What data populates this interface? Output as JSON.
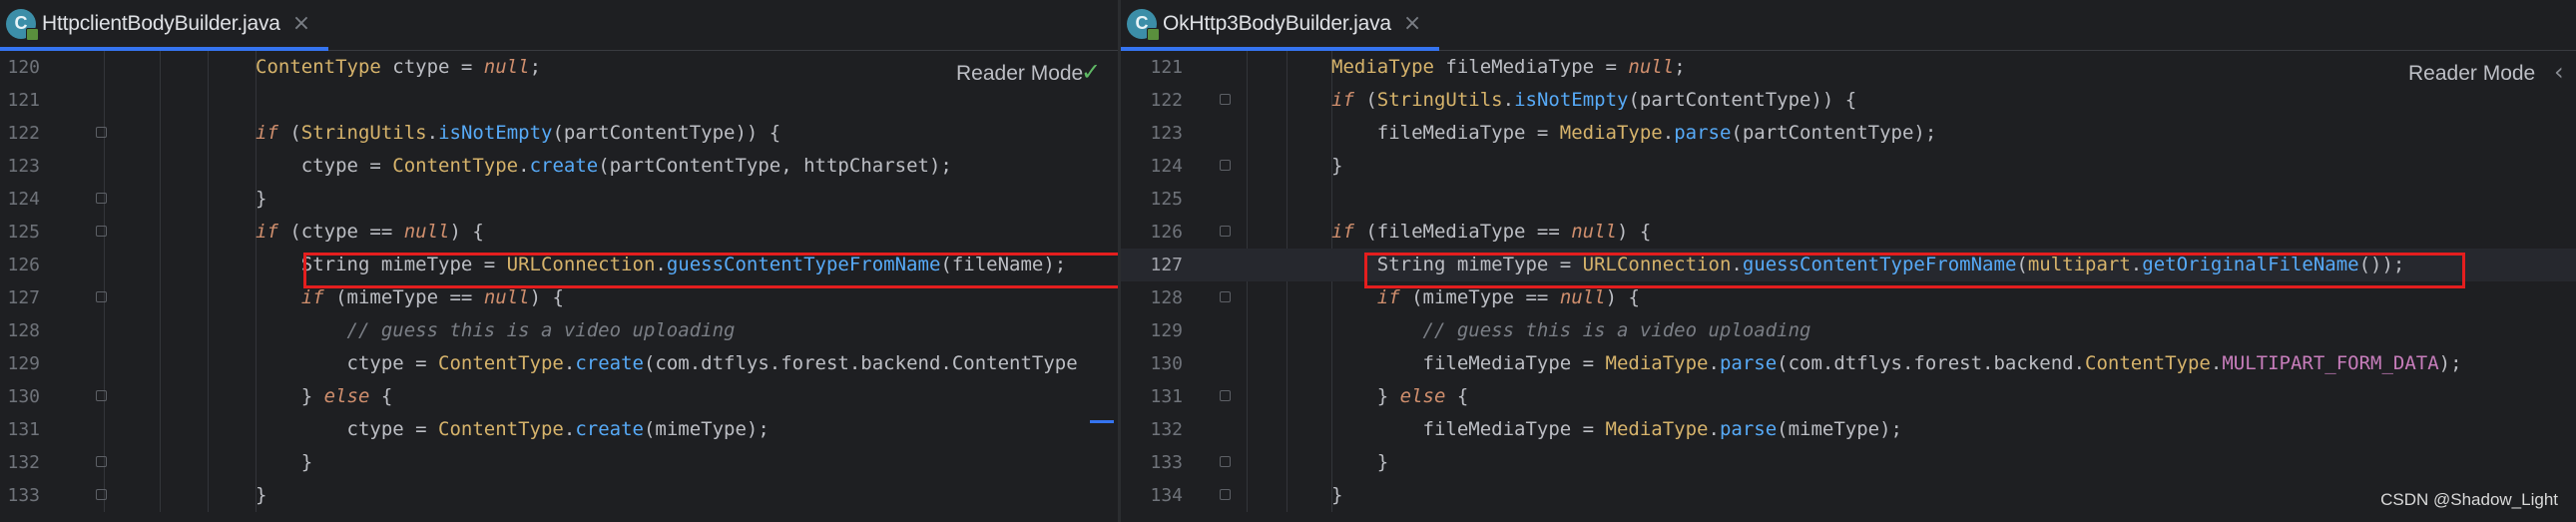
{
  "left": {
    "tab": {
      "title": "HttpclientBodyBuilder.java",
      "close": "×"
    },
    "reader_mode": "Reader Mode",
    "lines": [
      {
        "n": "120",
        "tokens": [
          {
            "t": "ContentType",
            "c": "ty"
          },
          {
            "t": " ctype = "
          },
          {
            "t": "null",
            "c": "kw"
          },
          {
            "t": ";"
          }
        ]
      },
      {
        "n": "121",
        "tokens": []
      },
      {
        "n": "122",
        "tokens": [
          {
            "t": "if",
            "c": "kw"
          },
          {
            "t": " ("
          },
          {
            "t": "StringUtils",
            "c": "ty"
          },
          {
            "t": "."
          },
          {
            "t": "isNotEmpty",
            "c": "me"
          },
          {
            "t": "(partContentType)) {"
          }
        ]
      },
      {
        "n": "123",
        "tokens": [
          {
            "t": "    ctype = "
          },
          {
            "t": "ContentType",
            "c": "ty"
          },
          {
            "t": "."
          },
          {
            "t": "create",
            "c": "me"
          },
          {
            "t": "(partContentType, httpCharset);"
          }
        ]
      },
      {
        "n": "124",
        "tokens": [
          {
            "t": "}"
          }
        ]
      },
      {
        "n": "125",
        "tokens": [
          {
            "t": "if",
            "c": "kw"
          },
          {
            "t": " (ctype == "
          },
          {
            "t": "null",
            "c": "kw"
          },
          {
            "t": ") {"
          }
        ]
      },
      {
        "n": "126",
        "tokens": [
          {
            "t": "    String mimeType = "
          },
          {
            "t": "URLConnection",
            "c": "ty"
          },
          {
            "t": "."
          },
          {
            "t": "guessContentTypeFromName",
            "c": "me"
          },
          {
            "t": "(fileName);"
          }
        ]
      },
      {
        "n": "127",
        "tokens": [
          {
            "t": "    "
          },
          {
            "t": "if",
            "c": "kw"
          },
          {
            "t": " (mimeType == "
          },
          {
            "t": "null",
            "c": "kw"
          },
          {
            "t": ") {"
          }
        ]
      },
      {
        "n": "128",
        "tokens": [
          {
            "t": "        "
          },
          {
            "t": "// guess this is a video uploading",
            "c": "cm"
          }
        ]
      },
      {
        "n": "129",
        "tokens": [
          {
            "t": "        ctype = "
          },
          {
            "t": "ContentType",
            "c": "ty"
          },
          {
            "t": "."
          },
          {
            "t": "create",
            "c": "me"
          },
          {
            "t": "(com.dtflys.forest.backend.ContentType"
          }
        ]
      },
      {
        "n": "130",
        "tokens": [
          {
            "t": "    } "
          },
          {
            "t": "else",
            "c": "kw"
          },
          {
            "t": " {"
          }
        ]
      },
      {
        "n": "131",
        "tokens": [
          {
            "t": "        ctype = "
          },
          {
            "t": "ContentType",
            "c": "ty"
          },
          {
            "t": "."
          },
          {
            "t": "create",
            "c": "me"
          },
          {
            "t": "(mimeType);"
          }
        ]
      },
      {
        "n": "132",
        "tokens": [
          {
            "t": "    }"
          }
        ]
      },
      {
        "n": "133",
        "tokens": [
          {
            "t": "}"
          }
        ]
      }
    ]
  },
  "right": {
    "tab": {
      "title": "OkHttp3BodyBuilder.java",
      "close": "×"
    },
    "reader_mode": "Reader Mode",
    "lines": [
      {
        "n": "121",
        "tokens": [
          {
            "t": "MediaType",
            "c": "ty"
          },
          {
            "t": " fileMediaType = "
          },
          {
            "t": "null",
            "c": "kw"
          },
          {
            "t": ";"
          }
        ]
      },
      {
        "n": "122",
        "tokens": [
          {
            "t": "if",
            "c": "kw"
          },
          {
            "t": " ("
          },
          {
            "t": "StringUtils",
            "c": "ty"
          },
          {
            "t": "."
          },
          {
            "t": "isNotEmpty",
            "c": "me"
          },
          {
            "t": "(partContentType)) {"
          }
        ]
      },
      {
        "n": "123",
        "tokens": [
          {
            "t": "    fileMediaType = "
          },
          {
            "t": "MediaType",
            "c": "ty"
          },
          {
            "t": "."
          },
          {
            "t": "parse",
            "c": "me"
          },
          {
            "t": "(partContentType);"
          }
        ]
      },
      {
        "n": "124",
        "tokens": [
          {
            "t": "}"
          }
        ]
      },
      {
        "n": "125",
        "tokens": []
      },
      {
        "n": "126",
        "tokens": [
          {
            "t": "if",
            "c": "kw"
          },
          {
            "t": " (fileMediaType == "
          },
          {
            "t": "null",
            "c": "kw"
          },
          {
            "t": ") {"
          }
        ]
      },
      {
        "n": "127",
        "tokens": [
          {
            "t": "    String mimeType = "
          },
          {
            "t": "URLConnection",
            "c": "ty"
          },
          {
            "t": "."
          },
          {
            "t": "guessContentTypeFromName",
            "c": "me"
          },
          {
            "t": "("
          },
          {
            "t": "multipart",
            "c": "ty"
          },
          {
            "t": "."
          },
          {
            "t": "getOriginalFileName",
            "c": "me"
          },
          {
            "t": "());"
          }
        ]
      },
      {
        "n": "128",
        "tokens": [
          {
            "t": "    "
          },
          {
            "t": "if",
            "c": "kw"
          },
          {
            "t": " (mimeType == "
          },
          {
            "t": "null",
            "c": "kw"
          },
          {
            "t": ") {"
          }
        ]
      },
      {
        "n": "129",
        "tokens": [
          {
            "t": "        "
          },
          {
            "t": "// guess this is a video uploading",
            "c": "cm"
          }
        ]
      },
      {
        "n": "130",
        "tokens": [
          {
            "t": "        fileMediaType = "
          },
          {
            "t": "MediaType",
            "c": "ty"
          },
          {
            "t": "."
          },
          {
            "t": "parse",
            "c": "me"
          },
          {
            "t": "(com.dtflys.forest.backend."
          },
          {
            "t": "ContentType",
            "c": "ty"
          },
          {
            "t": "."
          },
          {
            "t": "MULTIPART_FORM_DATA",
            "c": "cn"
          },
          {
            "t": ");"
          }
        ]
      },
      {
        "n": "131",
        "tokens": [
          {
            "t": "    } "
          },
          {
            "t": "else",
            "c": "kw"
          },
          {
            "t": " {"
          }
        ]
      },
      {
        "n": "132",
        "tokens": [
          {
            "t": "        fileMediaType = "
          },
          {
            "t": "MediaType",
            "c": "ty"
          },
          {
            "t": "."
          },
          {
            "t": "parse",
            "c": "me"
          },
          {
            "t": "(mimeType);"
          }
        ]
      },
      {
        "n": "133",
        "tokens": [
          {
            "t": "    }"
          }
        ]
      },
      {
        "n": "134",
        "tokens": [
          {
            "t": "}"
          }
        ]
      }
    ]
  },
  "watermark": "CSDN @Shadow_Light",
  "colors": {
    "highlight_box": "#e41e1e",
    "tab_underline": "#3574f0"
  }
}
